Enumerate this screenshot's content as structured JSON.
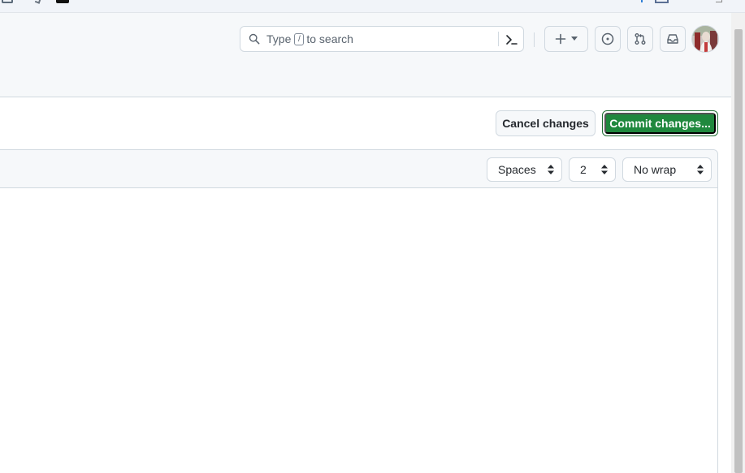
{
  "header": {
    "search": {
      "prefix": "Type",
      "key": "/",
      "suffix": "to search"
    }
  },
  "actions": {
    "cancel_label": "Cancel changes",
    "commit_label": "Commit changes..."
  },
  "editor_toolbar": {
    "indent_mode": "Spaces",
    "indent_size": "2",
    "wrap_mode": "No wrap"
  },
  "icons": {
    "search": "search-icon",
    "command": "command-palette-icon",
    "plus": "plus-icon",
    "caret": "triangle-down-icon",
    "issues": "issue-opened-icon",
    "pulls": "git-pull-request-icon",
    "inbox": "inbox-icon",
    "select_arrows": "select-arrows-icon"
  },
  "colors": {
    "primary_green": "#1f883d",
    "header_bg": "#f6f8fa",
    "border": "#d1d9e0"
  }
}
